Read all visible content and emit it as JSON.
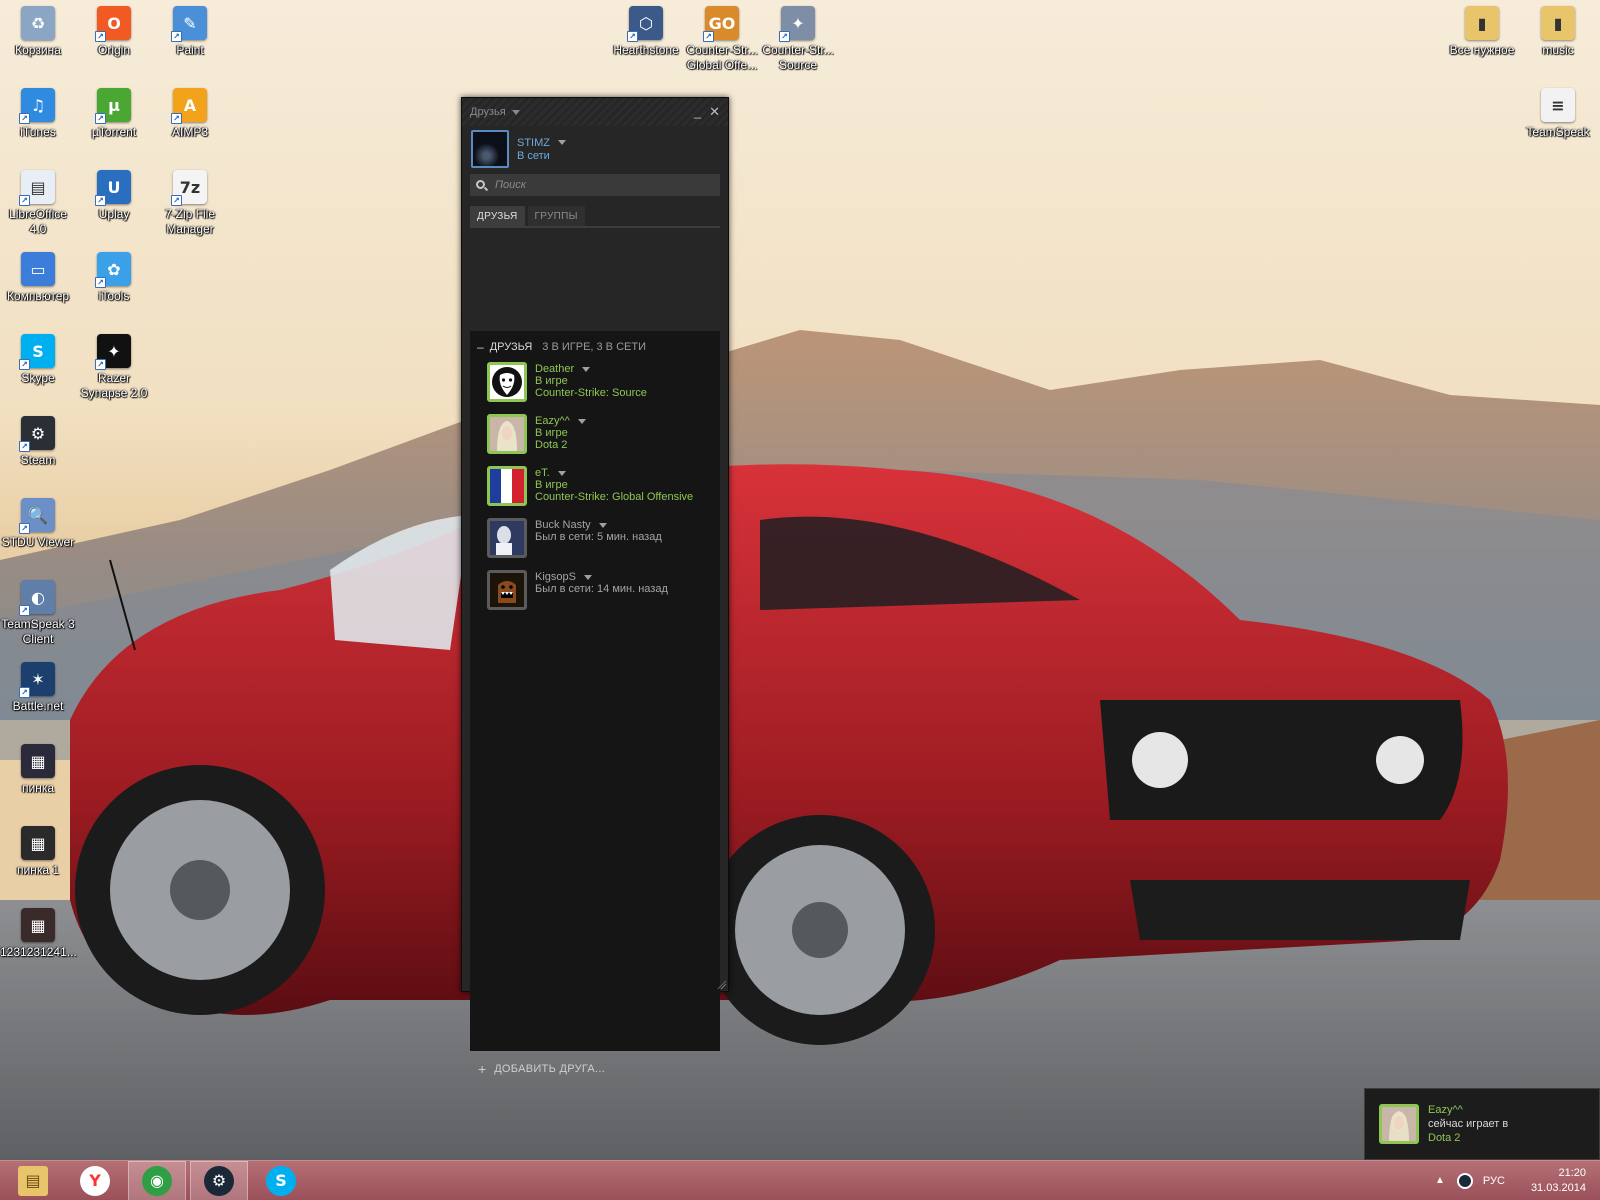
{
  "desktop": {
    "icons": [
      {
        "label": "Корзина",
        "icon": "recycle-bin-icon",
        "color": "#8aa6c4",
        "glyph": "♻"
      },
      {
        "label": "Origin",
        "icon": "origin-icon",
        "color": "#f15a22",
        "glyph": "O"
      },
      {
        "label": "Paint",
        "icon": "paint-icon",
        "color": "#4a90d9",
        "glyph": "✎"
      },
      {
        "label": "iTunes",
        "icon": "itunes-icon",
        "color": "#2f8be0",
        "glyph": "♫"
      },
      {
        "label": "µTorrent",
        "icon": "utorrent-icon",
        "color": "#4aa832",
        "glyph": "µ"
      },
      {
        "label": "AIMP3",
        "icon": "aimp-icon",
        "color": "#f2a21b",
        "glyph": "A"
      },
      {
        "label": "LibreOffice\n4.0",
        "icon": "libreoffice-icon",
        "color": "#e8eef5",
        "glyph": "▤"
      },
      {
        "label": "Uplay",
        "icon": "uplay-icon",
        "color": "#2a6fbf",
        "glyph": "U"
      },
      {
        "label": "7-Zip File\nManager",
        "icon": "7zip-icon",
        "color": "#f4f4f4",
        "glyph": "7z"
      },
      {
        "label": "Компьютер",
        "icon": "computer-icon",
        "color": "#3b7dd8",
        "glyph": "▭"
      },
      {
        "label": "iTools",
        "icon": "itools-icon",
        "color": "#3aa0e8",
        "glyph": "✿"
      },
      {
        "label": "Skype",
        "icon": "skype-icon",
        "color": "#00aff0",
        "glyph": "S"
      },
      {
        "label": "Razer\nSynapse 2.0",
        "icon": "razer-icon",
        "color": "#111111",
        "glyph": "✦"
      },
      {
        "label": "Steam",
        "icon": "steam-icon",
        "color": "#2a2f36",
        "glyph": "⚙"
      },
      {
        "label": "STDU Viewer",
        "icon": "stdu-viewer-icon",
        "color": "#6b8fc7",
        "glyph": "🔍"
      },
      {
        "label": "TeamSpeak 3\nClient",
        "icon": "teamspeak-icon",
        "color": "#5f7fa8",
        "glyph": "◐"
      },
      {
        "label": "Battle.net",
        "icon": "battlenet-icon",
        "color": "#1d3f6e",
        "glyph": "✶"
      },
      {
        "label": "пинка",
        "icon": "video-file-icon",
        "color": "#2a2a3a",
        "glyph": "▦"
      },
      {
        "label": "пинка 1",
        "icon": "image-file-icon",
        "color": "#2a2a2a",
        "glyph": "▦"
      },
      {
        "label": "1231231241...",
        "icon": "image-file-icon",
        "color": "#3a2a2a",
        "glyph": "▦"
      },
      {
        "label": "Hearthstone",
        "icon": "hearthstone-icon",
        "color": "#3b5a8a",
        "glyph": "⬡"
      },
      {
        "label": "Counter-Str...\nGlobal Offe...",
        "icon": "csgo-icon",
        "color": "#d98a2b",
        "glyph": "GO"
      },
      {
        "label": "Counter-Str...\nSource",
        "icon": "cs-source-icon",
        "color": "#7e8ea6",
        "glyph": "✦"
      },
      {
        "label": "Все нужное",
        "icon": "folder-icon",
        "color": "#e8c46a",
        "glyph": "▮"
      },
      {
        "label": "music",
        "icon": "folder-icon",
        "color": "#e8c46a",
        "glyph": "▮"
      },
      {
        "label": "TeamSpeak",
        "icon": "text-file-icon",
        "color": "#f2f2f2",
        "glyph": "≡"
      }
    ]
  },
  "friends_window": {
    "title": "Друзья",
    "minimize": "_",
    "close": "✕",
    "me": {
      "name": "STIMZ",
      "status": "В сети"
    },
    "search_placeholder": "Поиск",
    "tabs": [
      "ДРУЗЬЯ",
      "ГРУППЫ"
    ],
    "group": {
      "collapse": "–",
      "title": "ДРУЗЬЯ",
      "count": "3 В ИГРЕ, 3 В СЕТИ"
    },
    "friends": [
      {
        "name": "Deather",
        "status": "В игре",
        "game": "Counter-Strike: Source",
        "state": "ingame",
        "avatar": "anonymous-mask"
      },
      {
        "name": "Eazy^^",
        "status": "В игре",
        "game": "Dota 2",
        "state": "ingame",
        "avatar": "girl-photo"
      },
      {
        "name": "eT.",
        "status": "В игре",
        "game": "Counter-Strike: Global Offensive",
        "state": "ingame",
        "avatar": "french-flag"
      },
      {
        "name": "Buck Nasty",
        "status": "Был в сети: 5 мин. назад",
        "game": "",
        "state": "offline",
        "avatar": "person-photo"
      },
      {
        "name": "KigsopS",
        "status": "Был в сети: 14 мин. назад",
        "game": "",
        "state": "offline",
        "avatar": "domo-monster"
      }
    ],
    "add_friend": "ДОБАВИТЬ ДРУГА...",
    "add_plus": "+"
  },
  "notification": {
    "name": "Eazy^^",
    "message": "сейчас играет в",
    "game": "Dota 2"
  },
  "taskbar": {
    "items": [
      {
        "name": "explorer",
        "icon": "file-explorer-icon",
        "color": "#e8c46a",
        "glyph": "▤",
        "active": false
      },
      {
        "name": "yandex",
        "icon": "yandex-browser-icon",
        "color": "#ff3333",
        "glyph": "Y",
        "active": false
      },
      {
        "name": "chrome",
        "icon": "chrome-icon",
        "color": "#2f9e44",
        "glyph": "◉",
        "active": true
      },
      {
        "name": "steam",
        "icon": "steam-icon",
        "color": "#1b2838",
        "glyph": "⚙",
        "active": true
      },
      {
        "name": "skype",
        "icon": "skype-icon",
        "color": "#00aff0",
        "glyph": "S",
        "active": false
      }
    ],
    "tray": {
      "chevron": "▲",
      "lang": "РУС",
      "time": "21:20",
      "date": "31.03.2014"
    }
  },
  "colors": {
    "ingame": "#8ec654",
    "online": "#6fa9dc",
    "offline": "#a4a4a4"
  }
}
